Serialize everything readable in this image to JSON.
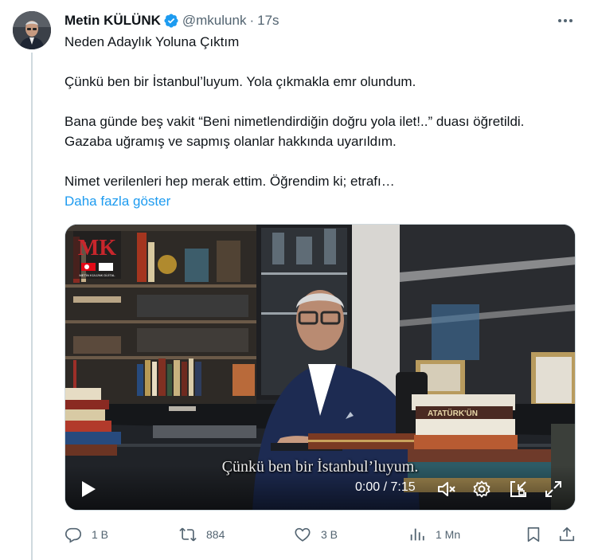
{
  "author": {
    "display_name": "Metin KÜLÜNK",
    "handle": "@mkulunk",
    "separator": "·",
    "timestamp": "17s",
    "verified": true
  },
  "tweet": {
    "lines": [
      "Neden Adaylık Yoluna Çıktım",
      "",
      "Çünkü ben bir İstanbul’luyum. Yola çıkmakla emr olundum.",
      "",
      "Bana günde beş vakit “Beni nimetlendirdiğin doğru yola ilet!..” duası öğretildi.",
      "Gazaba uğramış ve sapmış olanlar hakkında uyarıldım.",
      "",
      "Nimet verilenleri hep merak ettim. Öğrendim ki; etrafı…"
    ],
    "show_more_label": "Daha fazla göster"
  },
  "video": {
    "subtitle": "Çünkü ben bir İstanbul’luyum.",
    "timecode": "0:00 / 7:15",
    "watermark_letters": "MK",
    "watermark_caption": "METİN KÜLÜNK DİJİTAL",
    "book_spine_text": "ATATÜRK'ÜN"
  },
  "actions": {
    "reply_count": "1 B",
    "retweet_count": "884",
    "like_count": "3 B",
    "views_count": "1 Mn"
  },
  "colors": {
    "accent": "#1d9bf0",
    "secondary_text": "#536471",
    "verified_badge": "#1d9bf0"
  },
  "icons": [
    "verified-badge-icon",
    "more-icon",
    "play-icon",
    "mute-icon",
    "settings-icon",
    "pip-icon",
    "fullscreen-icon",
    "reply-icon",
    "retweet-icon",
    "like-icon",
    "views-icon",
    "bookmark-icon",
    "share-icon"
  ]
}
